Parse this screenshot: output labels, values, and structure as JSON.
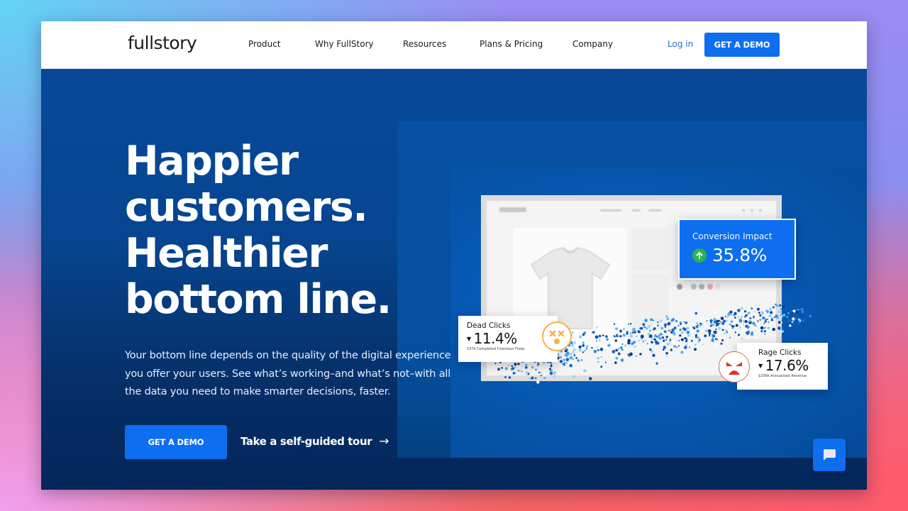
{
  "nav": {
    "logo": "fullstory",
    "links": [
      "Product",
      "Why FullStory",
      "Resources",
      "Plans & Pricing",
      "Company"
    ],
    "login": "Log in",
    "demo_button": "GET A DEMO"
  },
  "hero": {
    "headline": [
      "Happier",
      "customers.",
      "Healthier",
      "bottom line."
    ],
    "subtext": "Your bottom line depends on the quality of the digital experience you offer your users. See what’s working–and what’s not–with all the data you need to make smarter decisions, faster.",
    "demo_button": "GET A DEMO",
    "tour_link": "Take a self-guided tour",
    "tour_arrow": "→"
  },
  "cards": {
    "conversion": {
      "title": "Conversion Impact",
      "value": "35.8%",
      "icon": "arrow-up-circle-icon",
      "color": "#0d6ef0"
    },
    "dead_clicks": {
      "title": "Dead Clicks",
      "value": "11.4%",
      "note": "537k Completed Checkout Flows",
      "icon": "dizzy-face-icon"
    },
    "rage_clicks": {
      "title": "Rage Clicks",
      "value": "17.6%",
      "note": "$206k Annualized Revenue",
      "icon": "angry-face-icon"
    }
  },
  "colors": {
    "brand_blue": "#0d6ef0",
    "hero_bg": "#064690",
    "success_green": "#2eb352",
    "warning_yellow": "#f0b347",
    "rage_red": "#e0342b"
  },
  "chat": {
    "icon": "chat-bubble-icon"
  }
}
